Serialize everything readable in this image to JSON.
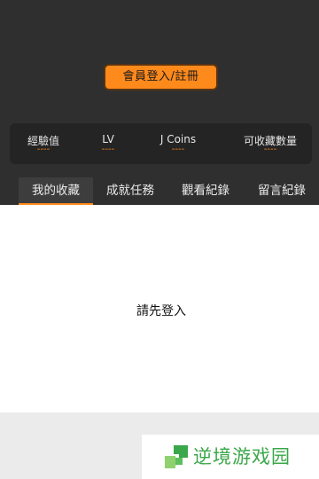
{
  "profile": {
    "login_button_label": "會員登入/註冊"
  },
  "stats": [
    {
      "label": "經驗值",
      "value": "----"
    },
    {
      "label": "LV",
      "value": "----"
    },
    {
      "label": "J Coins",
      "value": "----"
    },
    {
      "label": "可收藏數量",
      "value": "----"
    }
  ],
  "tabs": [
    {
      "label": "我的收藏",
      "active": true
    },
    {
      "label": "成就任務",
      "active": false
    },
    {
      "label": "觀看紀錄",
      "active": false
    },
    {
      "label": "留言紀錄",
      "active": false
    }
  ],
  "content": {
    "empty_message": "請先登入"
  },
  "watermark": {
    "text": "逆境游戏园"
  },
  "colors": {
    "header_bg": "#2f2f2f",
    "accent": "#ff8a1c",
    "stats_bg": "#242424",
    "watermark_green": "#3aa74a"
  }
}
